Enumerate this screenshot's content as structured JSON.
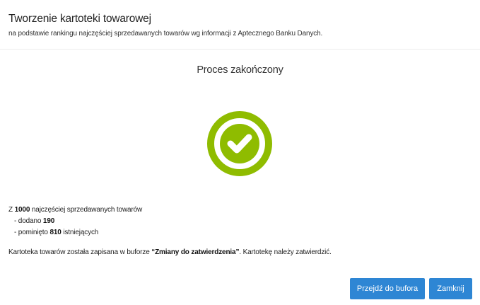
{
  "dialog": {
    "title": "Tworzenie kartoteki towarowej",
    "subtitle": "na podstawie rankingu najczęściej sprzedawanych towarów wg informacji z Aptecznego Banku Danych."
  },
  "status": {
    "heading": "Proces zakończony",
    "icon": "check-circle-icon",
    "icon_color": "#8fbc00"
  },
  "summary": {
    "prefix": "Z ",
    "total": "1000",
    "total_suffix": " najczęściej sprzedawanych towarów",
    "added_prefix": "-  dodano ",
    "added": "190",
    "skipped_prefix": "-  pominięto ",
    "skipped": "810",
    "skipped_suffix": " istniejących"
  },
  "note": {
    "prefix": "Kartoteka towarów została zapisana w buforze ",
    "buffer_name": "“Zmiany do zatwierdzenia”",
    "suffix": ". Kartotekę należy zatwierdzić."
  },
  "buttons": {
    "go_to_buffer": "Przejdź do bufora",
    "close": "Zamknij"
  },
  "colors": {
    "button": "#2e86d4",
    "success": "#8fbc00"
  }
}
